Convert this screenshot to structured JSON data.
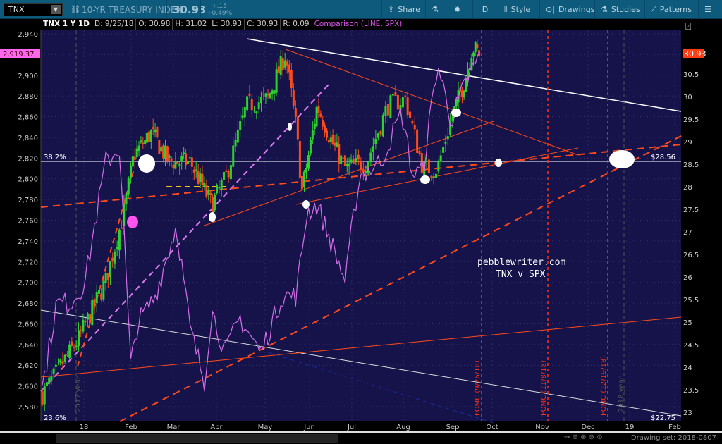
{
  "toolbar": {
    "symbol": "TNX",
    "title": "10-YR TREASURY INDEX",
    "last": "30.93",
    "change": "+.15",
    "change_pct": "+0.49%",
    "share": "Share",
    "period": "D",
    "style": "Style",
    "drawings": "Drawings",
    "studies": "Studies",
    "patterns": "Patterns"
  },
  "header": {
    "symbol": "TNX 1 Y 1D",
    "date": "D: 9/25/18",
    "open": "O: 30.98",
    "high": "H: 31.02",
    "low": "L: 30.93",
    "close": "C: 30.93",
    "range": "R: 0.09",
    "comparison": "Comparison (LINE, SPX)"
  },
  "left_axis": {
    "ticks": [
      "2,940",
      "2,920",
      "2,900",
      "2,880",
      "2,860",
      "2,840",
      "2,820",
      "2,800",
      "2,780",
      "2,760",
      "2,740",
      "2,720",
      "2,700",
      "2,680",
      "2,660",
      "2,640",
      "2,620",
      "2,600",
      "2,580"
    ],
    "current": "2,919.37"
  },
  "right_axis": {
    "ticks": [
      "30.5",
      "30",
      "29.5",
      "29",
      "28.5",
      "28",
      "27.5",
      "27",
      "26.5",
      "26",
      "25.5",
      "25",
      "24.5",
      "24",
      "23.5",
      "23"
    ],
    "current": "30.93"
  },
  "x_axis": [
    "18",
    "Feb",
    "Mar",
    "Apr",
    "May",
    "Jun",
    "Jul",
    "Aug",
    "Sep",
    "Oct",
    "Nov",
    "Dec",
    "19",
    "Feb"
  ],
  "annotations": {
    "fib_382": "38.2%",
    "fib_236": "23.6%",
    "price_2856": "$28.56",
    "price_2275": "$22.75",
    "watermark1": "pebblewriter.com",
    "watermark2": "TNX v SPX",
    "fomc1": "FOMC (9/26/18)",
    "fomc2": "FOMC (11/8/18)",
    "fomc3": "FOMC (12/19/18)",
    "year2017": "2017 year",
    "year2018": "2018 year"
  },
  "footer": {
    "drawing_set": "Drawing set: 2018-0807"
  },
  "colors": {
    "up": "#2fd12f",
    "down": "#ff4a1a",
    "spx": "#d46ee8",
    "bg": "#15134a",
    "toolbar": "#0e5a7c"
  },
  "chart_data": {
    "type": "candlestick+line",
    "x_unit": "months since Jan 1 2018",
    "tnx": {
      "name": "TNX",
      "axis": "right",
      "points": [
        [
          -0.88,
          23.4
        ],
        [
          -0.13,
          24.6
        ],
        [
          0.46,
          25.9
        ],
        [
          0.84,
          27.4
        ],
        [
          1.06,
          28.7
        ],
        [
          1.48,
          29.2
        ],
        [
          1.9,
          28.55
        ],
        [
          2.39,
          28.55
        ],
        [
          2.89,
          27.6
        ],
        [
          3.19,
          28.2
        ],
        [
          3.62,
          29.8
        ],
        [
          4.06,
          29.95
        ],
        [
          4.46,
          30.95
        ],
        [
          4.7,
          29.3
        ],
        [
          4.83,
          27.9
        ],
        [
          5.18,
          29.8
        ],
        [
          5.52,
          29.0
        ],
        [
          5.85,
          28.4
        ],
        [
          6.29,
          28.55
        ],
        [
          6.7,
          29.8
        ],
        [
          7.04,
          29.95
        ],
        [
          7.4,
          28.4
        ],
        [
          7.69,
          28.4
        ],
        [
          7.97,
          29.5
        ],
        [
          8.32,
          30.4
        ],
        [
          8.5,
          31.1
        ],
        [
          8.68,
          30.93
        ]
      ]
    },
    "spx": {
      "name": "SPX",
      "axis": "left",
      "points": [
        [
          -0.88,
          2598
        ],
        [
          -0.58,
          2680
        ],
        [
          -0.28,
          2680
        ],
        [
          0.02,
          2700
        ],
        [
          0.46,
          2816
        ],
        [
          0.76,
          2830
        ],
        [
          0.99,
          2619
        ],
        [
          1.15,
          2660
        ],
        [
          1.57,
          2687
        ],
        [
          2.07,
          2755
        ],
        [
          2.39,
          2654
        ],
        [
          2.72,
          2605
        ],
        [
          2.89,
          2673
        ],
        [
          3.19,
          2632
        ],
        [
          3.48,
          2666
        ],
        [
          3.91,
          2632
        ],
        [
          4.38,
          2687
        ],
        [
          4.7,
          2687
        ],
        [
          4.94,
          2768
        ],
        [
          5.18,
          2775
        ],
        [
          5.68,
          2720
        ],
        [
          5.85,
          2700
        ],
        [
          6.15,
          2803
        ],
        [
          6.56,
          2816
        ],
        [
          6.97,
          2864
        ],
        [
          7.19,
          2803
        ],
        [
          7.4,
          2809
        ],
        [
          7.69,
          2911
        ],
        [
          7.97,
          2857
        ],
        [
          8.32,
          2891
        ],
        [
          8.68,
          2919
        ]
      ]
    },
    "left_ylim": [
      2580,
      2940
    ],
    "right_ylim": [
      23,
      30.5
    ]
  }
}
